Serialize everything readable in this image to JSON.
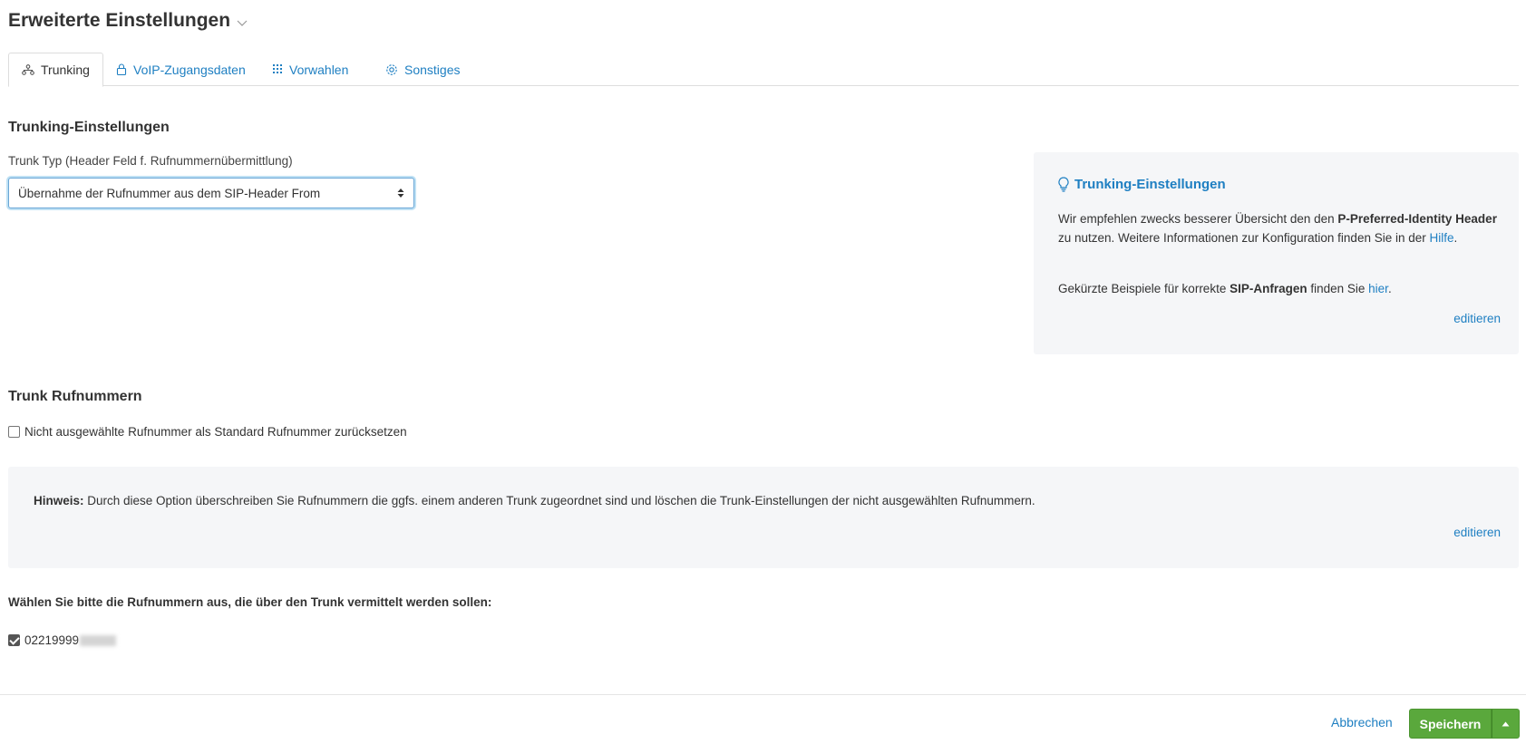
{
  "page": {
    "title": "Erweiterte Einstellungen"
  },
  "tabs": [
    {
      "label": "Trunking",
      "icon": "network-icon",
      "active": true
    },
    {
      "label": "VoIP-Zugangsdaten",
      "icon": "lock-icon",
      "active": false
    },
    {
      "label": "Vorwahlen",
      "icon": "dialpad-icon",
      "active": false
    },
    {
      "label": "Sonstiges",
      "icon": "gear-icon",
      "active": false
    }
  ],
  "trunking": {
    "section_title": "Trunking-Einstellungen",
    "field_label": "Trunk Typ (Header Feld f. Rufnummernübermittlung)",
    "selected_value": "Übernahme der Rufnummer aus dem SIP-Header From"
  },
  "info": {
    "title": "Trunking-Einstellungen",
    "p1_a": "Wir empfehlen zwecks besserer Übersicht den den ",
    "p1_bold": "P-Preferred-Identity Header",
    "p1_b": " zu nutzen. Weitere Informationen zur Konfiguration finden Sie in der ",
    "p1_link": "Hilfe",
    "p1_c": ".",
    "p2_a": "Gekürzte Beispiele für korrekte ",
    "p2_bold": "SIP-Anfragen",
    "p2_b": " finden Sie ",
    "p2_link": "hier",
    "p2_c": ".",
    "edit_label": "editieren"
  },
  "numbers": {
    "section_title": "Trunk Rufnummern",
    "reset_label": "Nicht ausgewählte Rufnummer als Standard Rufnummer zurücksetzen",
    "reset_checked": false,
    "hint_bold": "Hinweis:",
    "hint_text": " Durch diese Option überschreiben Sie Rufnummern die ggfs. einem anderen Trunk zugeordnet sind und löschen die Trunk-Einstellungen der nicht ausgewählten Rufnummern.",
    "hint_edit_label": "editieren",
    "select_prompt": "Wählen Sie bitte die Rufnummern aus, die über den Trunk vermittelt werden sollen:",
    "items": [
      {
        "number": "02219999",
        "checked": true
      }
    ]
  },
  "footer": {
    "cancel_label": "Abbrechen",
    "save_label": "Speichern"
  },
  "colors": {
    "link": "#1e7fc2",
    "save": "#5aa83c",
    "panel": "#f5f6f8"
  }
}
